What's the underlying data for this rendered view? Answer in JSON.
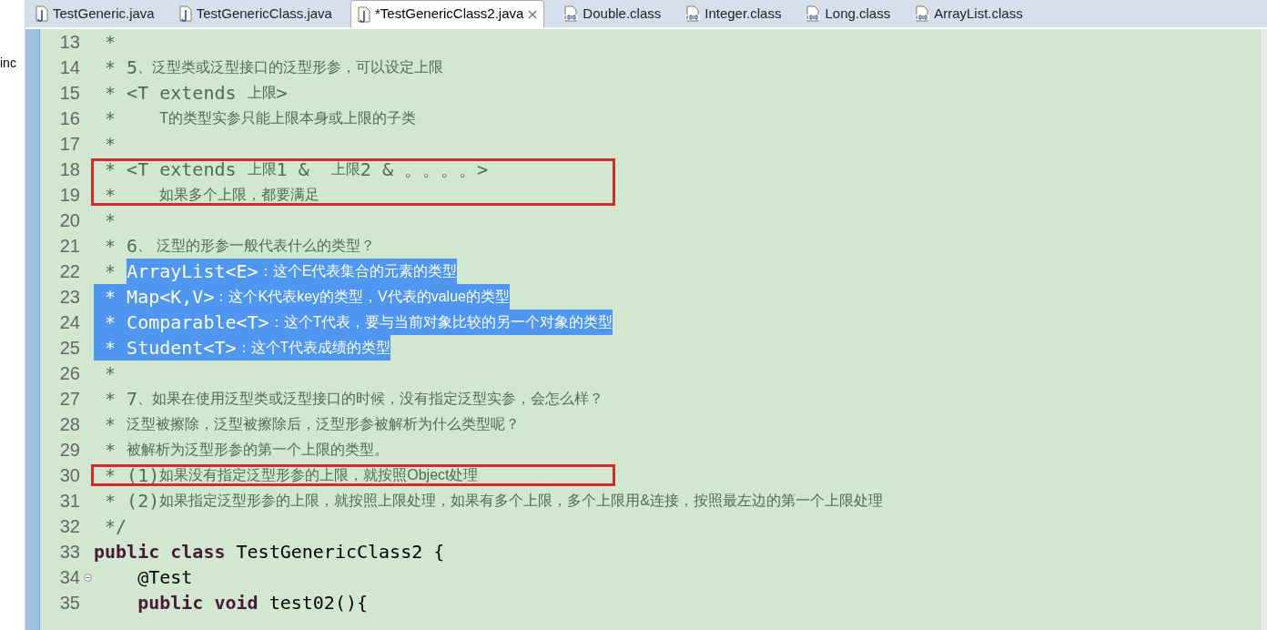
{
  "side_panel": {
    "label": "inc"
  },
  "tabs": [
    {
      "label": "TestGeneric.java",
      "kind": "java",
      "selected": false
    },
    {
      "label": "TestGenericClass.java",
      "kind": "java",
      "selected": false
    },
    {
      "label": "*TestGenericClass2.java",
      "kind": "java",
      "selected": true
    },
    {
      "label": "Double.class",
      "kind": "class",
      "selected": false
    },
    {
      "label": "Integer.class",
      "kind": "class",
      "selected": false
    },
    {
      "label": "Long.class",
      "kind": "class",
      "selected": false
    },
    {
      "label": "ArrayList.class",
      "kind": "class",
      "selected": false
    }
  ],
  "editor": {
    "lines": [
      {
        "number": "13",
        "boxed": false,
        "segments": [
          {
            "kind": "mono",
            "text": " *",
            "selected": false
          }
        ]
      },
      {
        "number": "14",
        "boxed": false,
        "segments": [
          {
            "kind": "mono",
            "text": " * 5",
            "selected": false
          },
          {
            "kind": "cjk",
            "text": "、泛型类或泛型接口的泛型形参，可以设定上限",
            "selected": false
          }
        ]
      },
      {
        "number": "15",
        "boxed": false,
        "segments": [
          {
            "kind": "mono",
            "text": " * <T extends ",
            "selected": false
          },
          {
            "kind": "cjk",
            "text": "上限",
            "selected": false
          },
          {
            "kind": "mono",
            "text": ">",
            "selected": false
          }
        ]
      },
      {
        "number": "16",
        "boxed": false,
        "segments": [
          {
            "kind": "mono",
            "text": " *    ",
            "selected": false
          },
          {
            "kind": "cjk",
            "text": "T的类型实参只能上限本身或上限的子类",
            "selected": false
          }
        ]
      },
      {
        "number": "17",
        "boxed": false,
        "segments": [
          {
            "kind": "mono",
            "text": " *",
            "selected": false
          }
        ]
      },
      {
        "number": "18",
        "boxed": true,
        "segments": [
          {
            "kind": "mono",
            "text": " * <T extends ",
            "selected": false
          },
          {
            "kind": "cjk",
            "text": "上限",
            "selected": false
          },
          {
            "kind": "mono",
            "text": "1 &  ",
            "selected": false
          },
          {
            "kind": "cjk",
            "text": "上限",
            "selected": false
          },
          {
            "kind": "mono",
            "text": "2 & 。。。。>",
            "selected": false
          }
        ]
      },
      {
        "number": "19",
        "boxed": true,
        "segments": [
          {
            "kind": "mono",
            "text": " *    ",
            "selected": false
          },
          {
            "kind": "cjk",
            "text": "如果多个上限，都要满足",
            "selected": false
          }
        ]
      },
      {
        "number": "20",
        "boxed": false,
        "segments": [
          {
            "kind": "mono",
            "text": " *",
            "selected": false
          }
        ]
      },
      {
        "number": "21",
        "boxed": false,
        "segments": [
          {
            "kind": "mono",
            "text": " * 6",
            "selected": false
          },
          {
            "kind": "cjk",
            "text": "、 泛型的形参一般代表什么的类型？",
            "selected": false
          }
        ]
      },
      {
        "number": "22",
        "boxed": false,
        "segments": [
          {
            "kind": "mono",
            "text": " * ",
            "selected": false
          },
          {
            "kind": "mono",
            "text": "ArrayList<E>",
            "selected": true
          },
          {
            "kind": "cjk",
            "text": "：这个E代表集合的元素的类型",
            "selected": true
          }
        ]
      },
      {
        "number": "23",
        "boxed": false,
        "segments": [
          {
            "kind": "mono",
            "text": " * Map<K,V>",
            "selected": true
          },
          {
            "kind": "cjk",
            "text": "：这个K代表key的类型，V代表的value的类型",
            "selected": true
          }
        ]
      },
      {
        "number": "24",
        "boxed": false,
        "segments": [
          {
            "kind": "mono",
            "text": " * Comparable<T>",
            "selected": true
          },
          {
            "kind": "cjk",
            "text": "：这个T代表，要与当前对象比较的另一个对象的类型",
            "selected": true
          }
        ]
      },
      {
        "number": "25",
        "boxed": false,
        "segments": [
          {
            "kind": "mono",
            "text": " * Student<T>",
            "selected": true
          },
          {
            "kind": "cjk",
            "text": "：这个T代表成绩的类型",
            "selected": true
          }
        ]
      },
      {
        "number": "26",
        "boxed": false,
        "segments": [
          {
            "kind": "mono",
            "text": " *",
            "selected": false
          }
        ]
      },
      {
        "number": "27",
        "boxed": false,
        "segments": [
          {
            "kind": "mono",
            "text": " * 7",
            "selected": false
          },
          {
            "kind": "cjk",
            "text": "、如果在使用泛型类或泛型接口的时候，没有指定泛型实参，会怎么样？",
            "selected": false
          }
        ]
      },
      {
        "number": "28",
        "boxed": false,
        "segments": [
          {
            "kind": "mono",
            "text": " * ",
            "selected": false
          },
          {
            "kind": "cjk",
            "text": "泛型被擦除，泛型被擦除后，泛型形参被解析为什么类型呢？",
            "selected": false
          }
        ]
      },
      {
        "number": "29",
        "boxed": false,
        "segments": [
          {
            "kind": "mono",
            "text": " * ",
            "selected": false
          },
          {
            "kind": "cjk",
            "text": "被解析为泛型形参的第一个上限的类型。",
            "selected": false
          }
        ]
      },
      {
        "number": "30",
        "boxed": true,
        "segments": [
          {
            "kind": "mono",
            "text": " * (1)",
            "selected": false
          },
          {
            "kind": "cjk",
            "text": "如果没有指定泛型形参的上限，就按照Object处理",
            "selected": false
          }
        ]
      },
      {
        "number": "31",
        "boxed": false,
        "segments": [
          {
            "kind": "mono",
            "text": " * (2)",
            "selected": false
          },
          {
            "kind": "cjk",
            "text": "如果指定泛型形参的上限，就按照上限处理，如果有多个上限，多个上限用&连接，按照最左边的第一个上限处理",
            "selected": false
          }
        ]
      },
      {
        "number": "32",
        "boxed": false,
        "segments": [
          {
            "kind": "mono",
            "text": " */",
            "selected": false
          }
        ]
      },
      {
        "number": "33",
        "boxed": false,
        "segments": [
          {
            "kind": "keyword",
            "text": "public class",
            "selected": false
          },
          {
            "kind": "code",
            "text": " TestGenericClass2 {",
            "selected": false
          }
        ]
      },
      {
        "number": "34",
        "boxed": false,
        "fold": true,
        "segments": [
          {
            "kind": "code",
            "text": "    @Test",
            "selected": false
          }
        ]
      },
      {
        "number": "35",
        "boxed": false,
        "segments": [
          {
            "kind": "keyword",
            "text": "    public void",
            "selected": false
          },
          {
            "kind": "code",
            "text": " test02(){",
            "selected": false
          }
        ]
      }
    ]
  }
}
